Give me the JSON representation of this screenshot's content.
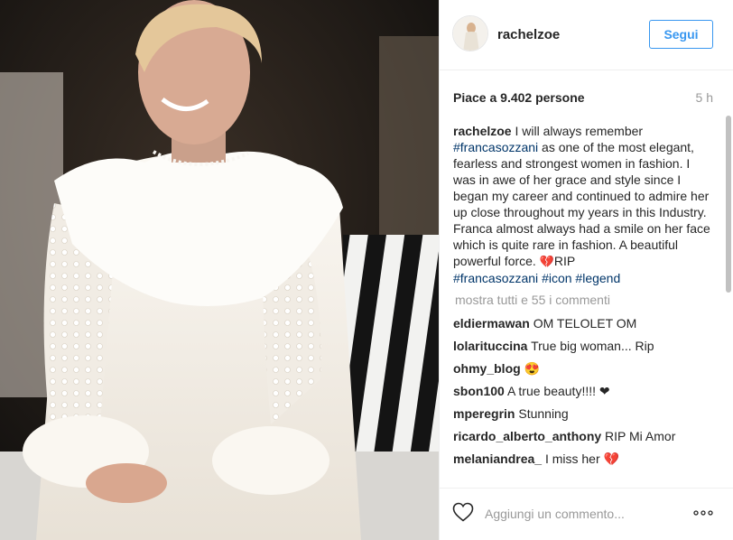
{
  "post": {
    "username": "rachelzoe",
    "follow_label": "Segui",
    "likes_text": "Piace a 9.402 persone",
    "time_text": "5 h"
  },
  "caption": {
    "username": "rachelzoe",
    "text_1": " I will always remember ",
    "tag_1": "#francasozzani",
    "text_2": " as one of the most elegant, fearless and strongest women in fashion. I was in awe of her grace and style since I began my career and continued to admire her up close throughout my years in this Industry. Franca almost always had a smile on her face which is quite rare in fashion. A beautiful powerful force. ",
    "emoji": "💔",
    "text_3": "RIP",
    "tag_2": "#francasozzani",
    "tag_3": "#icon",
    "tag_4": "#legend"
  },
  "show_all_text": "mostra tutti e 55 i commenti",
  "comments": [
    {
      "user": "eldiermawan",
      "text": "OM TELOLET OM"
    },
    {
      "user": "lolarituccina",
      "text": "True big woman... Rip"
    },
    {
      "user": "ohmy_blog",
      "text": "😍"
    },
    {
      "user": "sbon100",
      "text": "A true beauty!!!! ❤"
    },
    {
      "user": "mperegrin",
      "text": "Stunning"
    },
    {
      "user": "ricardo_alberto_anthony",
      "text": "RIP Mi Amor"
    },
    {
      "user": "melaniandrea_",
      "text": "I miss her 💔"
    }
  ],
  "footer": {
    "comment_placeholder": "Aggiungi un commento...",
    "like_icon": "heart-outline-icon",
    "more_icon": "more-options-icon"
  },
  "colors": {
    "link_blue": "#003569",
    "follow_blue": "#3897f0",
    "muted": "#999999"
  }
}
